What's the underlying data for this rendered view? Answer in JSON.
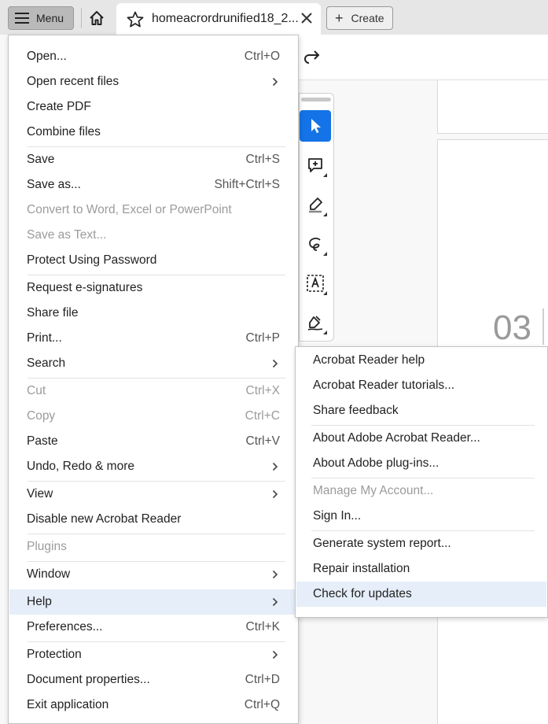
{
  "tabbar": {
    "menu_label": "Menu",
    "doc_title": "homeacrordrunified18_2...",
    "create_label": "Create"
  },
  "document": {
    "page_number": "03"
  },
  "menu": {
    "items": [
      {
        "label": "Open...",
        "shortcut": "Ctrl+O"
      },
      {
        "label": "Open recent files",
        "submenu": true
      },
      {
        "label": "Create PDF"
      },
      {
        "label": "Combine files"
      },
      {
        "label": "Save",
        "shortcut": "Ctrl+S"
      },
      {
        "label": "Save as...",
        "shortcut": "Shift+Ctrl+S"
      },
      {
        "label": "Convert to Word, Excel or PowerPoint",
        "disabled": true
      },
      {
        "label": "Save as Text...",
        "disabled": true
      },
      {
        "label": "Protect Using Password"
      },
      {
        "label": "Request e-signatures"
      },
      {
        "label": "Share file"
      },
      {
        "label": "Print...",
        "shortcut": "Ctrl+P"
      },
      {
        "label": "Search",
        "submenu": true
      },
      {
        "label": "Cut",
        "shortcut": "Ctrl+X",
        "disabled": true
      },
      {
        "label": "Copy",
        "shortcut": "Ctrl+C",
        "disabled": true
      },
      {
        "label": "Paste",
        "shortcut": "Ctrl+V"
      },
      {
        "label": "Undo, Redo & more",
        "submenu": true
      },
      {
        "label": "View",
        "submenu": true
      },
      {
        "label": "Disable new Acrobat Reader"
      },
      {
        "label": "Plugins",
        "disabled": true
      },
      {
        "label": "Window",
        "submenu": true
      },
      {
        "label": "Help",
        "submenu": true,
        "highlighted": true
      },
      {
        "label": "Preferences...",
        "shortcut": "Ctrl+K"
      },
      {
        "label": "Protection",
        "submenu": true
      },
      {
        "label": "Document properties...",
        "shortcut": "Ctrl+D"
      },
      {
        "label": "Exit application",
        "shortcut": "Ctrl+Q"
      }
    ]
  },
  "help_submenu": {
    "items": [
      {
        "label": "Acrobat Reader help"
      },
      {
        "label": "Acrobat Reader tutorials..."
      },
      {
        "label": "Share feedback"
      },
      {
        "label": "About Adobe Acrobat Reader..."
      },
      {
        "label": "About Adobe plug-ins..."
      },
      {
        "label": "Manage My Account...",
        "disabled": true
      },
      {
        "label": "Sign In..."
      },
      {
        "label": "Generate system report..."
      },
      {
        "label": "Repair installation"
      },
      {
        "label": "Check for updates",
        "highlighted": true
      }
    ]
  },
  "colors": {
    "accent": "#1473e6",
    "highlight": "#e5eef9",
    "disabled_text": "#9b9b9b"
  },
  "icons": [
    "menu-icon",
    "home-icon",
    "star-icon",
    "close-icon",
    "plus-icon",
    "redo-icon",
    "select-tool-icon",
    "add-comment-icon",
    "highlight-pen-icon",
    "draw-freeform-icon",
    "text-box-icon",
    "sign-pen-icon",
    "chevron-right-icon"
  ]
}
